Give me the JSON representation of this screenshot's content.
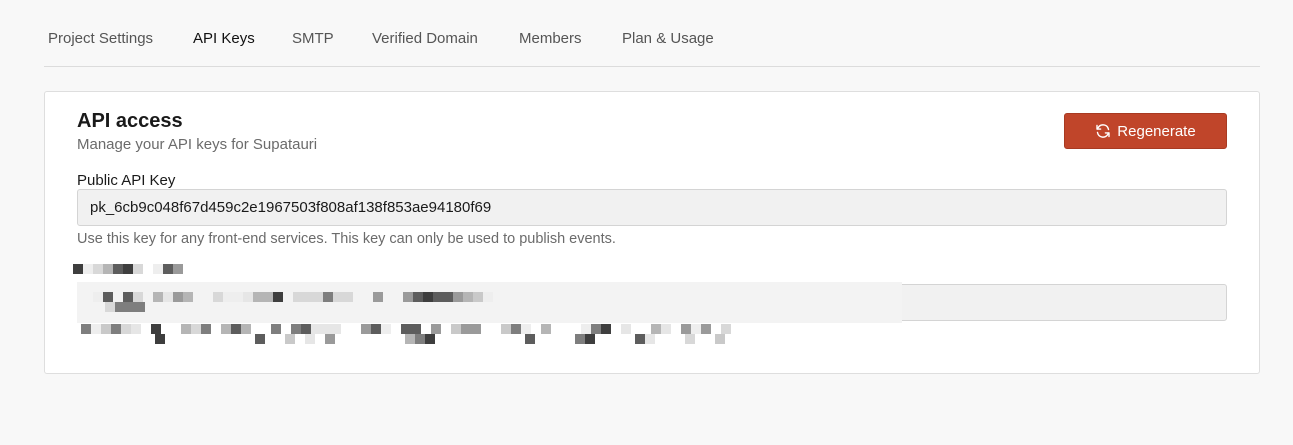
{
  "tabs": [
    {
      "label": "Project Settings",
      "active": false
    },
    {
      "label": "API Keys",
      "active": true
    },
    {
      "label": "SMTP",
      "active": false
    },
    {
      "label": "Verified Domain",
      "active": false
    },
    {
      "label": "Members",
      "active": false
    },
    {
      "label": "Plan & Usage",
      "active": false
    }
  ],
  "api_access": {
    "title": "API access",
    "subtitle": "Manage your API keys for Supatauri",
    "regenerate_label": "Regenerate",
    "regenerate_icon": "refresh-icon",
    "public_key_label": "Public API Key",
    "public_key_value": "pk_6cb9c048f67d459c2e1967503f808af138f853ae94180f69",
    "public_key_help": "Use this key for any front-end services. This key can only be used to publish events.",
    "secret_key_redacted": true
  },
  "colors": {
    "accent": "#c0452a",
    "background": "#f8f8f8",
    "card": "#ffffff",
    "muted_text": "#6b6b6b"
  }
}
